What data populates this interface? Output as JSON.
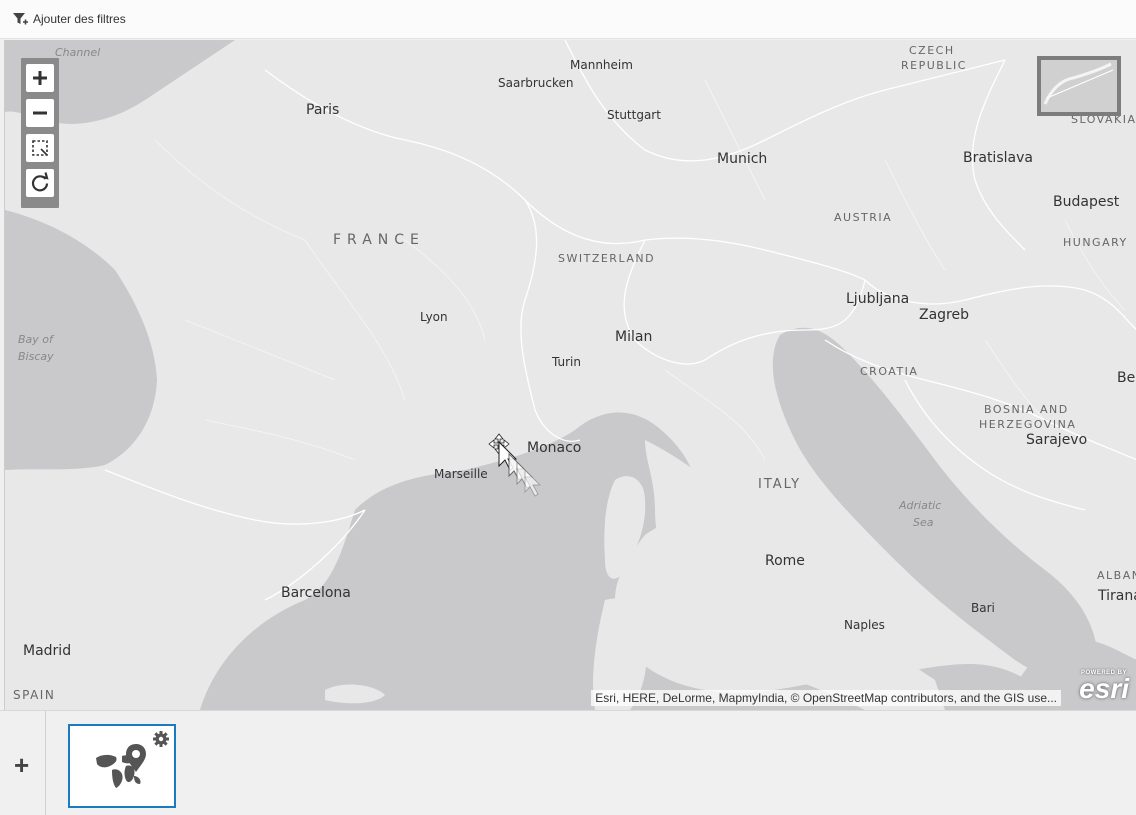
{
  "toolbar": {
    "add_filters_label": "Ajouter des filtres"
  },
  "map": {
    "labels": {
      "channel": "Channel",
      "paris": "Paris",
      "saarbrucken": "Saarbrucken",
      "mannheim": "Mannheim",
      "stuttgart": "Stuttgart",
      "czech": "CZECH",
      "republic": "REPUBLIC",
      "slovakia": "SLOVAKIA",
      "munich": "Munich",
      "bratislava": "Bratislava",
      "budapest": "Budapest",
      "austria": "AUSTRIA",
      "hungary": "HUNGARY",
      "france": "FRANCE",
      "switzerland": "SWITZERLAND",
      "bay": "Bay of",
      "biscay": "Biscay",
      "lyon": "Lyon",
      "milan": "Milan",
      "ljubljana": "Ljubljana",
      "zagreb": "Zagreb",
      "turin": "Turin",
      "croatia": "CROATIA",
      "bel": "Bel",
      "bosnia": "BOSNIA AND",
      "herzegovina": "HERZEGOVINA",
      "sarajevo": "Sarajevo",
      "monaco": "Monaco",
      "marseille": "Marseille",
      "italy": "ITALY",
      "adriatic": "Adriatic",
      "sea": "Sea",
      "rome": "Rome",
      "alban": "ALBAN",
      "tirana": "Tirana",
      "barcelona": "Barcelona",
      "bari": "Bari",
      "naples": "Naples",
      "madrid": "Madrid",
      "spain": "SPAIN"
    },
    "attribution": "Esri, HERE, DeLorme, MapmyIndia, © OpenStreetMap contributors, and the GIS use...",
    "logo_powered": "POWERED BY",
    "logo_text": "esri",
    "zoom_controls": [
      "zoom-in-icon",
      "zoom-out-icon",
      "zoom-box-icon",
      "refresh-icon"
    ]
  },
  "bottom": {
    "add_label": "+",
    "thumbnail_icons": [
      "world-map-pin-icon",
      "gear-icon"
    ]
  },
  "colors": {
    "land": "#e8e8e8",
    "water": "#c9c9cc",
    "selected_border": "#1a7bc0",
    "borders": "#ffffff"
  }
}
